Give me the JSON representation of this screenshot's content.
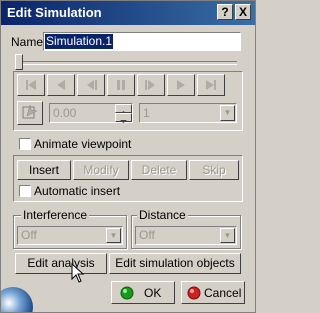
{
  "window": {
    "title": "Edit Simulation",
    "help_label": "?",
    "close_label": "X"
  },
  "name_field": {
    "label": "Name:",
    "value": "Simulation.1"
  },
  "player": {
    "step_value": "0.00",
    "step_select": "1"
  },
  "animate_viewpoint": {
    "label": "Animate viewpoint",
    "checked": false
  },
  "actions": {
    "insert": "Insert",
    "modify": "Modify",
    "delete": "Delete",
    "skip": "Skip"
  },
  "automatic_insert": {
    "label": "Automatic insert",
    "checked": false
  },
  "interference": {
    "title": "Interference",
    "value": "Off"
  },
  "distance": {
    "title": "Distance",
    "value": "Off"
  },
  "buttons": {
    "edit_analysis": "Edit analysis",
    "edit_simulation_objects": "Edit simulation objects",
    "ok": "OK",
    "cancel": "Cancel"
  },
  "colors": {
    "title_bar": "#0a246a",
    "selection": "#0a246a",
    "ok_green": "#1a9a1a",
    "cancel_red": "#cc2222"
  }
}
